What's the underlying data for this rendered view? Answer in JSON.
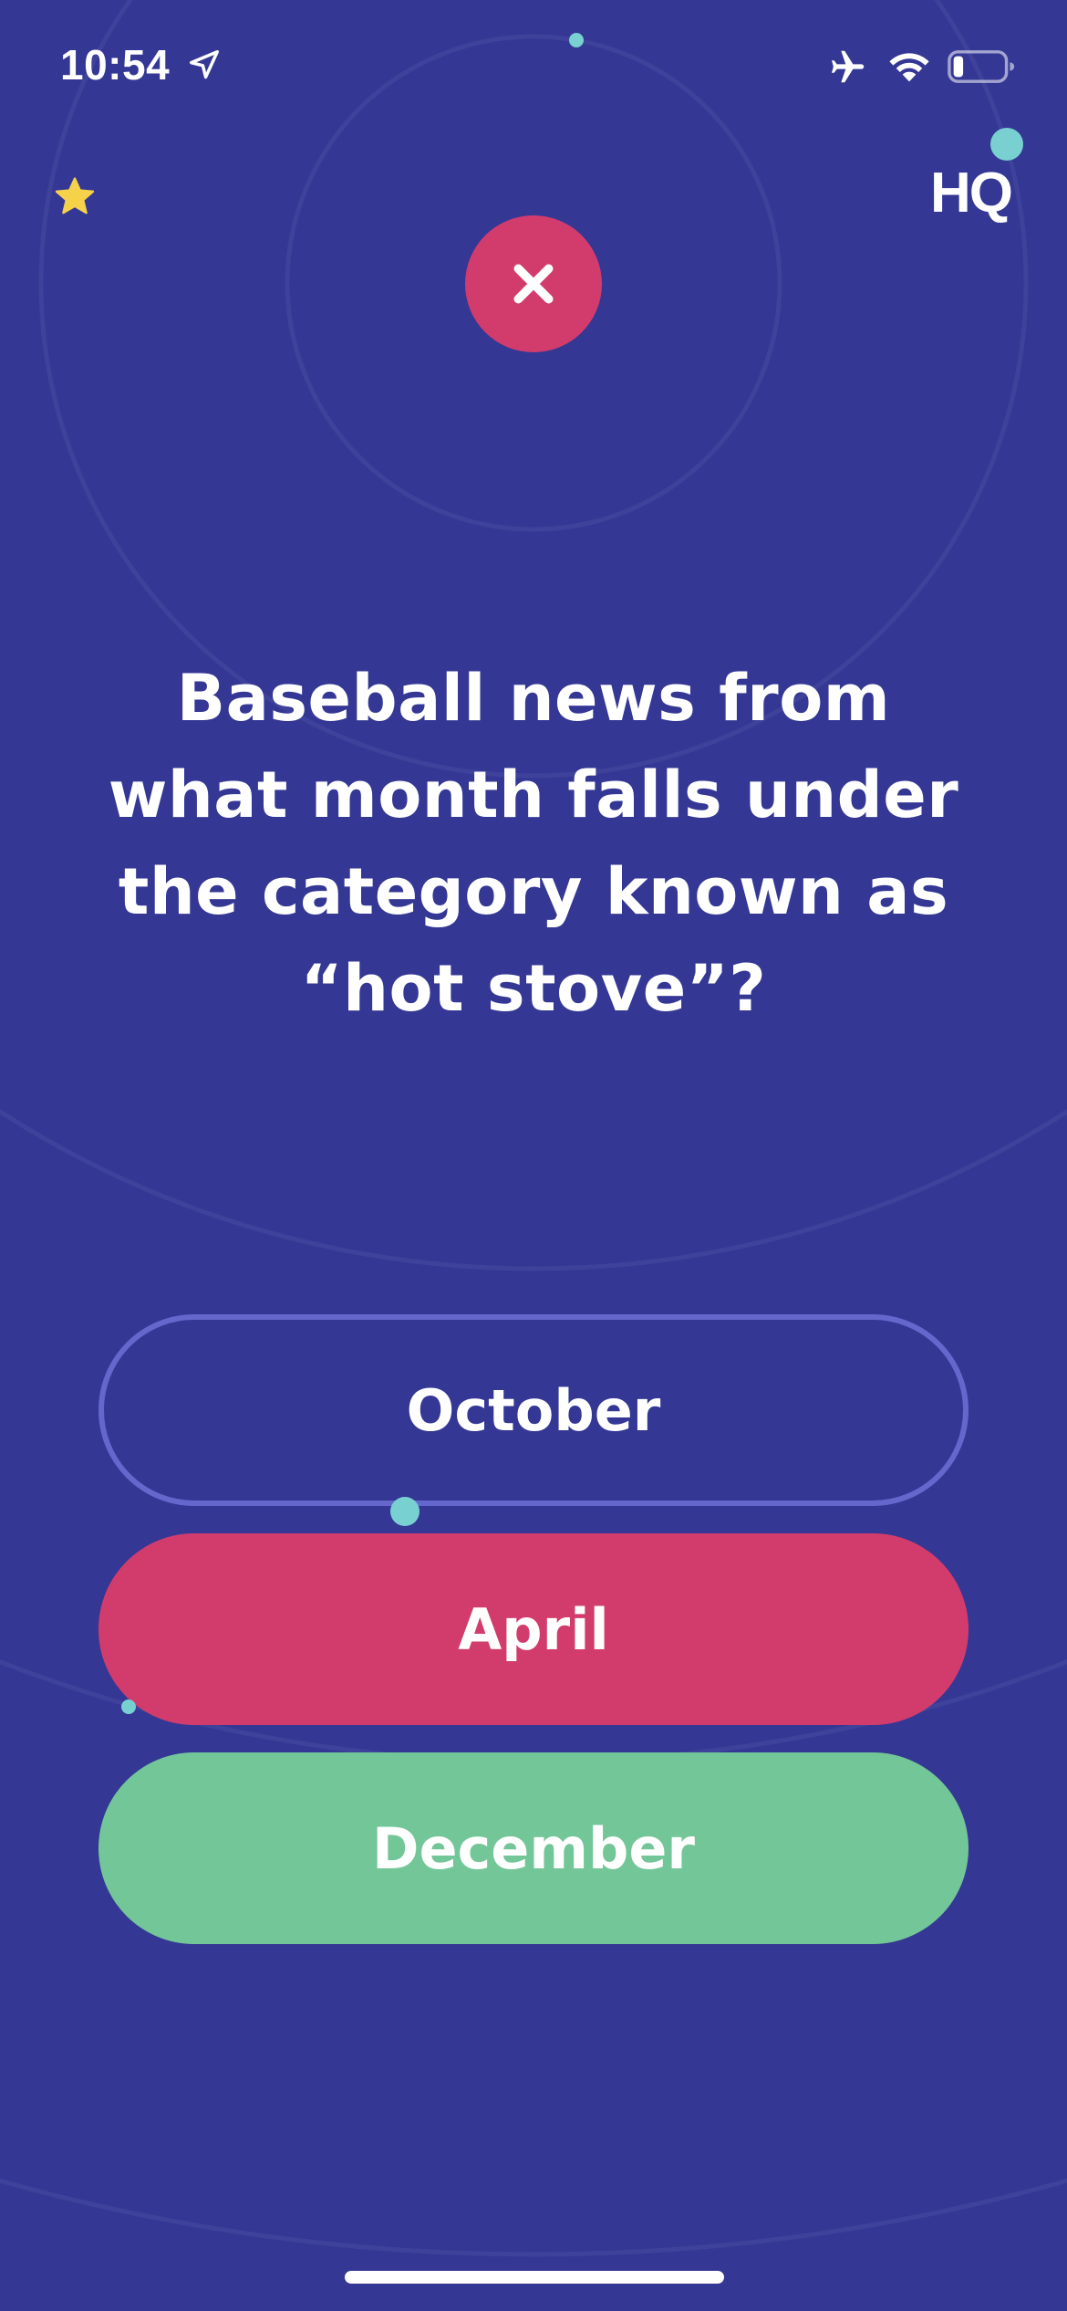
{
  "status_bar": {
    "time": "10:54",
    "icons": [
      "location-arrow-icon",
      "airplane-icon",
      "wifi-icon",
      "battery-icon"
    ],
    "battery_level": 0.2
  },
  "header": {
    "star_icon": "star-icon",
    "logo_text": "HQ"
  },
  "result": {
    "icon": "close-icon",
    "status": "wrong"
  },
  "question": {
    "text": "Baseball news from what month falls under the category known as “hot stove”?"
  },
  "answers": [
    {
      "label": "October",
      "state": "unselected"
    },
    {
      "label": "April",
      "state": "selected-wrong"
    },
    {
      "label": "December",
      "state": "correct"
    }
  ],
  "colors": {
    "background": "#343794",
    "wrong": "#d23c6c",
    "correct": "#73c698",
    "outline": "#6567cc",
    "accent": "#78d1d0",
    "star": "#f6d14a"
  }
}
